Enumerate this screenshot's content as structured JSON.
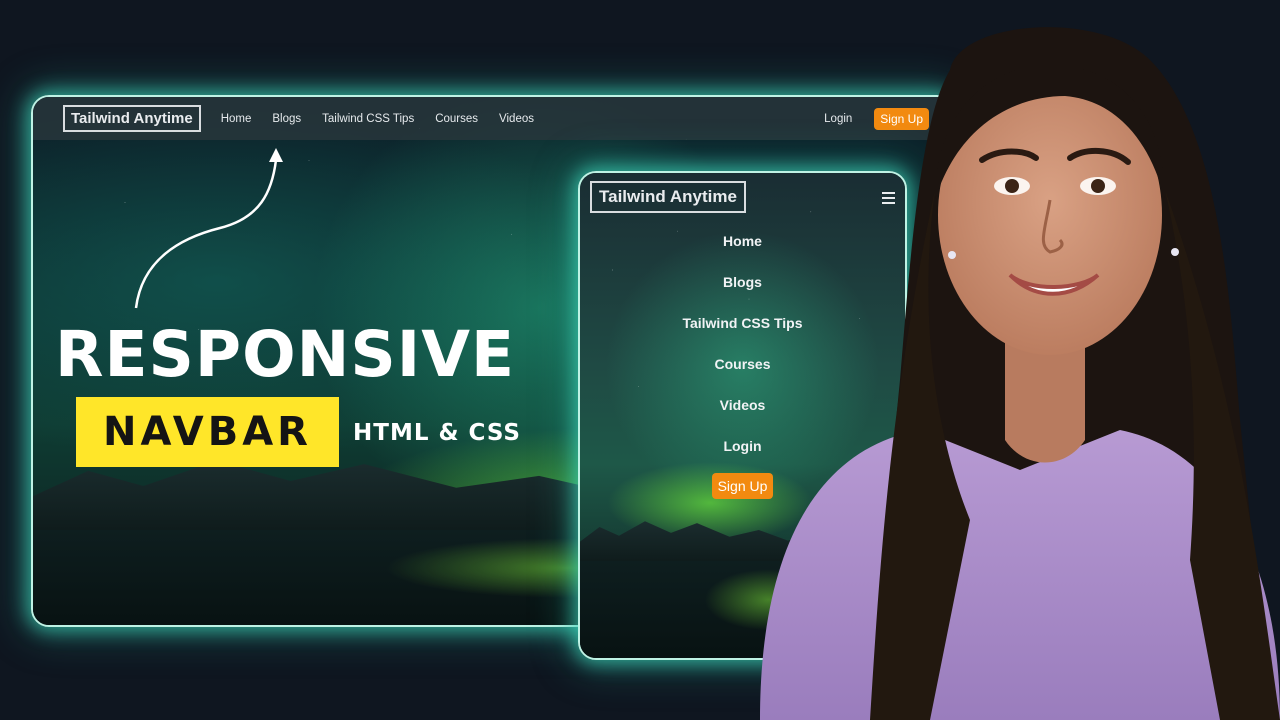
{
  "desktop_nav": {
    "logo": "Tailwind Anytime",
    "links": [
      "Home",
      "Blogs",
      "Tailwind CSS Tips",
      "Courses",
      "Videos"
    ],
    "login": "Login",
    "signup": "Sign Up"
  },
  "headline": {
    "title": "RESPONSIVE",
    "badge": "NAVBAR",
    "tech": "HTML & CSS"
  },
  "mobile_nav": {
    "logo": "Tailwind Anytime",
    "menu_icon": "hamburger-icon",
    "items": [
      "Home",
      "Blogs",
      "Tailwind CSS Tips",
      "Courses",
      "Videos",
      "Login"
    ],
    "signup": "Sign Up"
  },
  "colors": {
    "background": "#0f1620",
    "glow": "#40dcbe",
    "signup": "#f28a10",
    "badge": "#ffe629"
  }
}
